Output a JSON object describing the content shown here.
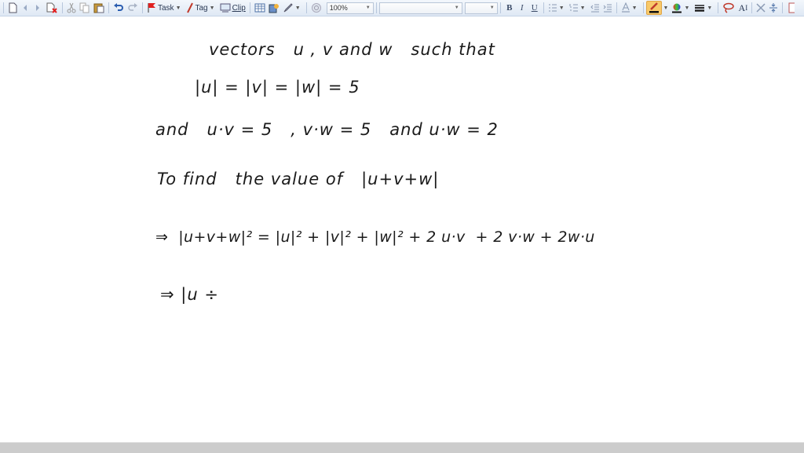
{
  "toolbar": {
    "task_label": "Task",
    "tag_label": "Tag",
    "clip_label": "Clip",
    "zoom_value": "100%",
    "font_value": "",
    "font_size_value": "",
    "bold_label": "B",
    "italic_label": "I",
    "underline_label": "U",
    "ai_label": "A",
    "accent_pen_color": "#f8c96a"
  },
  "notes": {
    "lines": [
      "vectors   u , v and w   such that",
      "|u| = |v| = |w| = 5",
      "and   u·v = 5   , v·w = 5   and u·w = 2",
      "To find   the value of   |u+v+w|",
      "⇒  |u+v+w|² = |u|² + |v|² + |w|² + 2 u·v  + 2 v·w + 2w·u",
      "⇒ |u ÷"
    ]
  }
}
